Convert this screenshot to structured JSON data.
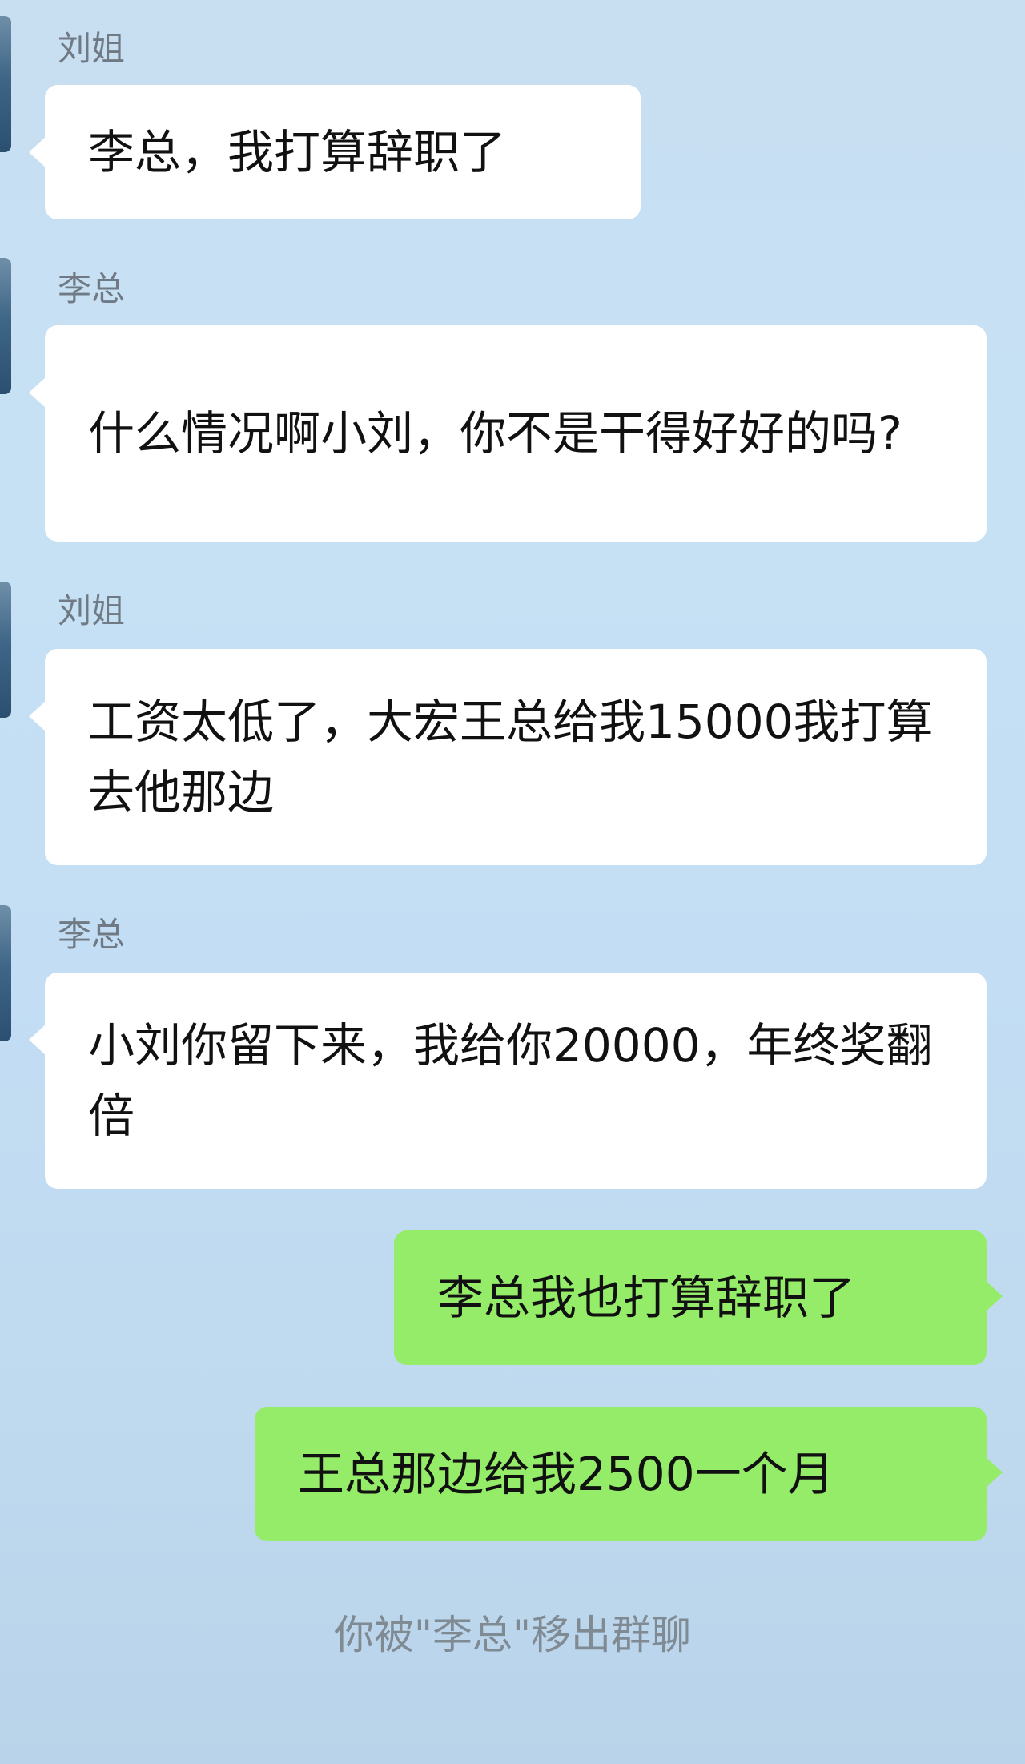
{
  "messages": [
    {
      "sender": "刘姐",
      "text": "李总，我打算辞职了",
      "side": "left"
    },
    {
      "sender": "李总",
      "text": "什么情况啊小刘，你不是干得好好的吗?",
      "side": "left"
    },
    {
      "sender": "刘姐",
      "text": "工资太低了，大宏王总给我15000我打算去他那边",
      "side": "left"
    },
    {
      "sender": "李总",
      "text": "小刘你留下来，我给你20000，年终奖翻倍",
      "side": "left"
    },
    {
      "text": "李总我也打算辞职了",
      "side": "right"
    },
    {
      "text": "王总那边给我2500一个月",
      "side": "right"
    }
  ],
  "system_notice": "你被\"李总\"移出群聊",
  "colors": {
    "incoming_bubble": "#ffffff",
    "outgoing_bubble": "#95ec69",
    "sender_name": "#6f7a84",
    "system_text": "#7f8a93"
  }
}
